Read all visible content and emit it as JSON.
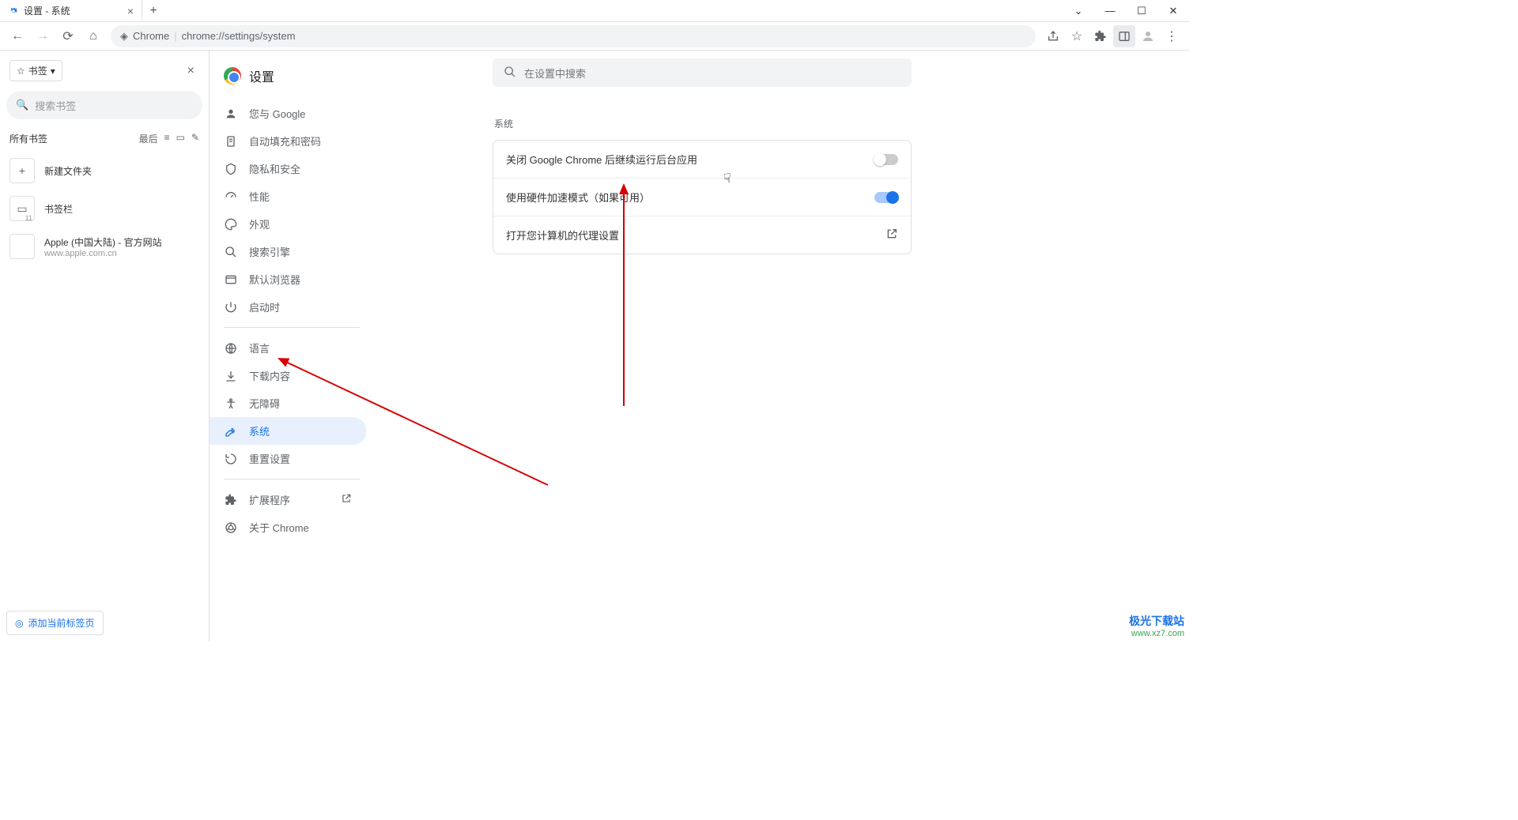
{
  "window": {
    "tab_title": "设置 - 系统",
    "url_chip": "Chrome",
    "url_path": "chrome://settings/system"
  },
  "bookmarks": {
    "chip_label": "书签",
    "search_placeholder": "搜索书签",
    "all_label": "所有书签",
    "sort_label": "最后",
    "new_folder": "新建文件夹",
    "bar_label": "书签栏",
    "bar_count": "11",
    "item1_title": "Apple (中国大陆) - 官方网站",
    "item1_sub": "www.apple.com.cn",
    "footer_btn": "添加当前标签页"
  },
  "settings": {
    "title": "设置",
    "search_placeholder": "在设置中搜索",
    "nav": [
      "您与 Google",
      "自动填充和密码",
      "隐私和安全",
      "性能",
      "外观",
      "搜索引擎",
      "默认浏览器",
      "启动时",
      "语言",
      "下载内容",
      "无障碍",
      "系统",
      "重置设置",
      "扩展程序",
      "关于 Chrome"
    ],
    "section_title": "系统",
    "row1": "关闭 Google Chrome 后继续运行后台应用",
    "row2": "使用硬件加速模式（如果可用）",
    "row3": "打开您计算机的代理设置"
  },
  "watermark": {
    "line1": "极光下载站",
    "line2": "www.xz7.com"
  }
}
